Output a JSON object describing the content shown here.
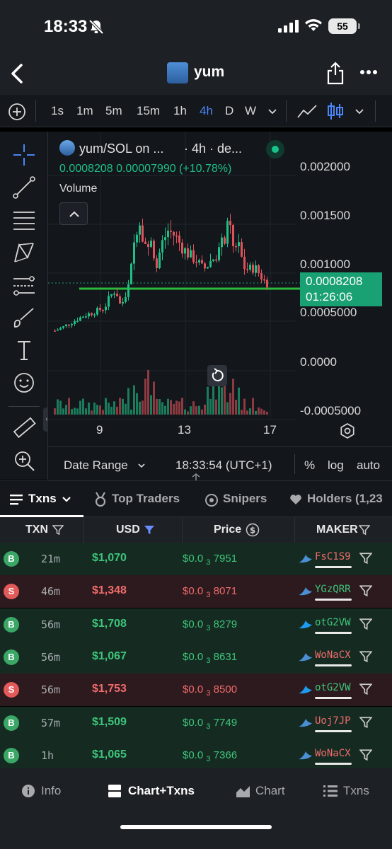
{
  "status": {
    "time": "18:33",
    "battery": "55"
  },
  "header": {
    "title": "yum"
  },
  "timeframes": [
    "1s",
    "1m",
    "5m",
    "15m",
    "1h",
    "4h",
    "D",
    "W"
  ],
  "active_timeframe": "4h",
  "chart": {
    "pair": "yum/SOL on ...",
    "interval": "· 4h · de...",
    "ohlc": "0.0008208  0.00007990 (+10.78%)",
    "volume_label": "Volume",
    "price_axis": [
      "0.002000",
      "0.001500",
      "0.001000",
      "0.0005000",
      "0.0000",
      "-0.0005000"
    ],
    "current_price": "0.0008208",
    "countdown": "01:26:06",
    "x_axis": [
      "9",
      "13",
      "17"
    ],
    "date_range_label": "Date Range",
    "clock": "18:33:54 (UTC+1)",
    "options": [
      "%",
      "log",
      "auto"
    ]
  },
  "colors": {
    "up": "#1fbf86",
    "down": "#e0525a",
    "accent": "#4a86f7",
    "support_line": "#2ecc40"
  },
  "tabs": [
    "Txns",
    "Top Traders",
    "Snipers",
    "Holders (1,23"
  ],
  "table": {
    "headers": [
      "TXN",
      "USD",
      "Price",
      "MAKER"
    ],
    "rows": [
      {
        "type": "B",
        "age": "21m",
        "usd": "$1,070",
        "price_prefix": "$0.0",
        "price_sub": "3",
        "price_digits": "7951",
        "maker": "FsC1S9"
      },
      {
        "type": "S",
        "age": "46m",
        "usd": "$1,348",
        "price_prefix": "$0.0",
        "price_sub": "3",
        "price_digits": "8071",
        "maker": "YGzQRR"
      },
      {
        "type": "B",
        "age": "56m",
        "usd": "$1,708",
        "price_prefix": "$0.0",
        "price_sub": "3",
        "price_digits": "8279",
        "maker": "otG2VW"
      },
      {
        "type": "B",
        "age": "56m",
        "usd": "$1,067",
        "price_prefix": "$0.0",
        "price_sub": "3",
        "price_digits": "8631",
        "maker": "WoNaCX"
      },
      {
        "type": "S",
        "age": "56m",
        "usd": "$1,753",
        "price_prefix": "$0.0",
        "price_sub": "3",
        "price_digits": "8500",
        "maker": "otG2VW"
      },
      {
        "type": "B",
        "age": "57m",
        "usd": "$1,509",
        "price_prefix": "$0.0",
        "price_sub": "3",
        "price_digits": "7749",
        "maker": "Uoj7JP"
      },
      {
        "type": "B",
        "age": "1h",
        "usd": "$1,065",
        "price_prefix": "$0.0",
        "price_sub": "3",
        "price_digits": "7366",
        "maker": "WoNaCX"
      }
    ]
  },
  "bottom_nav": [
    "Info",
    "Chart+Txns",
    "Chart",
    "Txns"
  ]
}
